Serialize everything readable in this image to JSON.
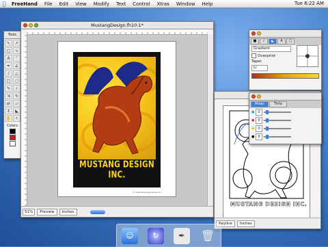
{
  "menubar": {
    "app": "FreeHand",
    "items": [
      "File",
      "Edit",
      "View",
      "Modify",
      "Text",
      "Control",
      "Xtras",
      "Window",
      "Help"
    ],
    "clock": "Tue 6:22 AM"
  },
  "tools": {
    "title": "Tools",
    "colors_label": "Colors"
  },
  "document": {
    "title": "MustangDesign.fh10:1*",
    "zoom": "51%",
    "view_mode": "Preview",
    "units": "Inches",
    "art_title": "MUSTANG DESIGN INC.",
    "credit": "© 2001 Mustang Design Inc."
  },
  "fill_panel": {
    "type": "Gradient",
    "overprint": "Overprint",
    "taper": "Taper",
    "taper_value": "Li"
  },
  "mixer_panel": {
    "tabs": [
      "Mixer",
      "Tints"
    ],
    "values": [
      "0",
      "0",
      "0",
      "0"
    ]
  },
  "document2": {
    "art_title": "MUSTANG DESIGN INC.",
    "view_mode": "Keyline",
    "units": "Inches"
  },
  "colors": {
    "accent": "#3c7de0",
    "artYellow": "#f6c21a",
    "horse": "#b43c12",
    "wing": "#1d2a8c"
  }
}
